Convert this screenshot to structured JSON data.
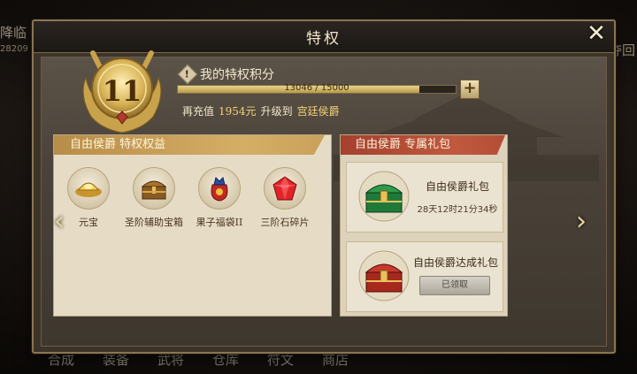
{
  "background": {
    "left_title": "降临",
    "left_number": "28209",
    "right_title": "夺回",
    "bottom_nav": [
      "合成",
      "装备",
      "武将",
      "仓库",
      "符文",
      "商店"
    ]
  },
  "dialog": {
    "title": "特权",
    "close_icon": "close-x-icon"
  },
  "rank": {
    "level": "11",
    "points_label": "我的特权积分",
    "points_current": 13046,
    "points_max": 15000,
    "progress_text": "13046 / 15000",
    "progress_fraction": 0.87,
    "recharge_prefix": "再充值",
    "recharge_amount": "1954元",
    "recharge_mid": "升级到",
    "recharge_target": "宫廷侯爵"
  },
  "benefits_panel": {
    "header": "自由侯爵 特权权益",
    "items": [
      {
        "label": "元宝",
        "icon": "gold-ingot-icon"
      },
      {
        "label": "圣阶辅助宝箱",
        "icon": "treasure-chest-icon"
      },
      {
        "label": "果子福袋II",
        "icon": "lucky-bag-icon"
      },
      {
        "label": "三阶石碎片",
        "icon": "red-gem-icon"
      }
    ]
  },
  "gifts_panel": {
    "header": "自由侯爵 专属礼包",
    "gifts": [
      {
        "name": "自由侯爵礼包",
        "timer": "28天12时21分34秒",
        "icon": "green-chest-icon"
      },
      {
        "name": "自由侯爵达成礼包",
        "button": "已领取",
        "icon": "red-chest-icon"
      }
    ]
  },
  "colors": {
    "gold_accent": "#d5ae66",
    "red_accent": "#b34e36",
    "panel_bg": "#e6dcc6"
  }
}
